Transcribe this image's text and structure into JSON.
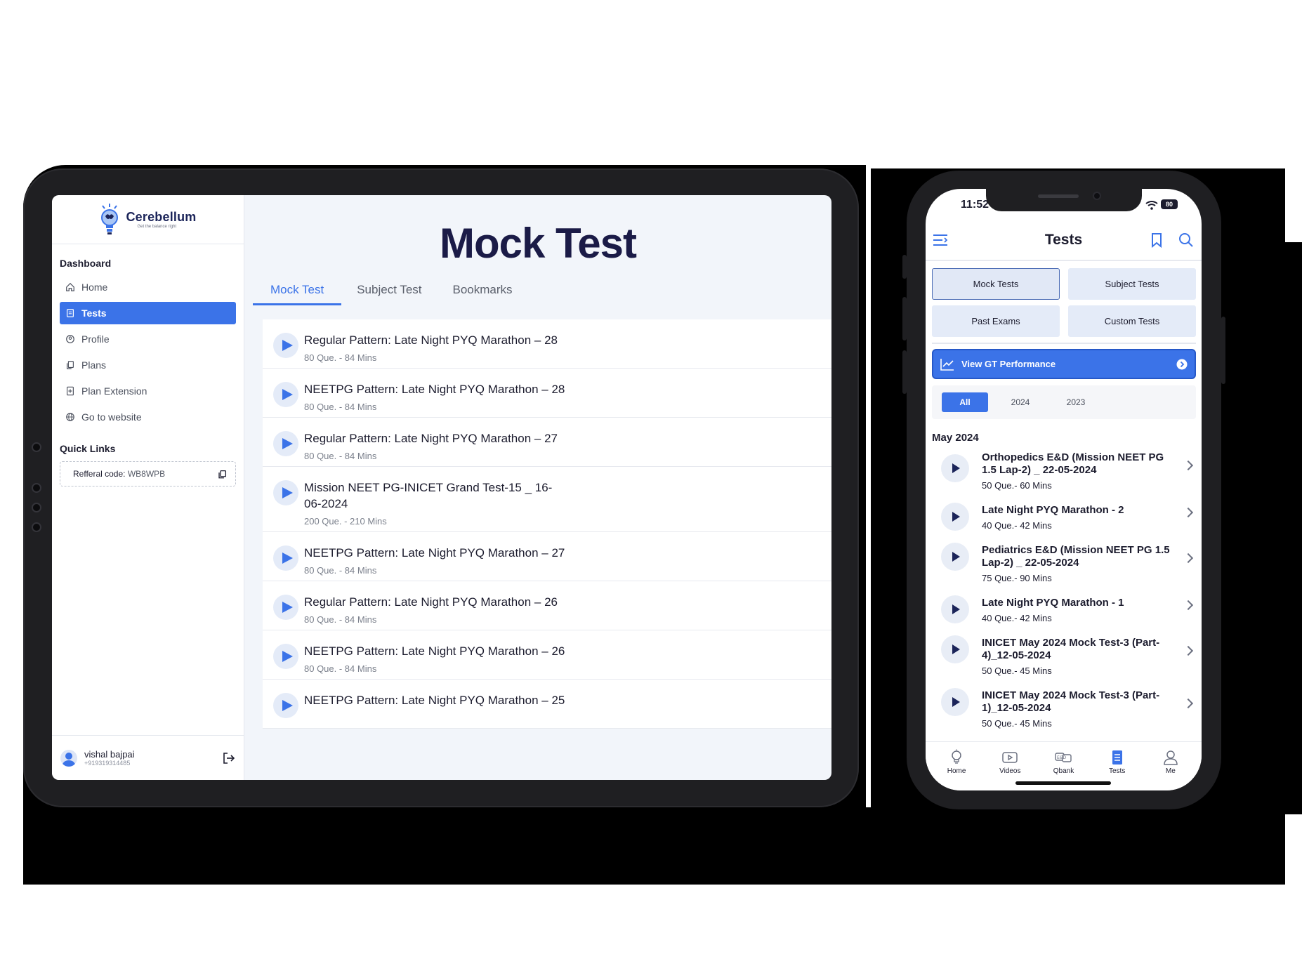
{
  "tablet": {
    "brand": {
      "name": "Cerebellum",
      "tagline": "Get the balance right"
    },
    "sidebar": {
      "section_label": "Dashboard",
      "items": [
        {
          "label": "Home",
          "icon": "home-icon"
        },
        {
          "label": "Tests",
          "icon": "document-icon",
          "active": true
        },
        {
          "label": "Profile",
          "icon": "user-circle-icon"
        },
        {
          "label": "Plans",
          "icon": "copy-icon"
        },
        {
          "label": "Plan Extension",
          "icon": "file-plus-icon"
        },
        {
          "label": "Go to website",
          "icon": "globe-icon"
        }
      ],
      "quick_links_label": "Quick Links",
      "referral_label": "Refferal code:",
      "referral_code": "WB8WPB"
    },
    "user": {
      "name": "vishal bajpai",
      "phone": "+919319314485"
    },
    "main": {
      "title": "Mock Test",
      "tabs": [
        "Mock Test",
        "Subject Test",
        "Bookmarks"
      ],
      "active_tab": "Mock Test",
      "tests": [
        {
          "title": "Regular Pattern: Late Night PYQ Marathon – 28",
          "meta": "80 Que. - 84 Mins"
        },
        {
          "title": "NEETPG Pattern: Late Night PYQ Marathon – 28",
          "meta": "80 Que. - 84 Mins"
        },
        {
          "title": "Regular Pattern: Late Night PYQ Marathon – 27",
          "meta": "80 Que. - 84 Mins"
        },
        {
          "title": "Mission NEET PG-INICET Grand Test-15 _ 16-06-2024",
          "meta": "200 Que. - 210 Mins"
        },
        {
          "title": "NEETPG Pattern: Late Night PYQ Marathon – 27",
          "meta": "80 Que. - 84 Mins"
        },
        {
          "title": "Regular Pattern: Late Night PYQ Marathon – 26",
          "meta": "80 Que. - 84 Mins"
        },
        {
          "title": "NEETPG Pattern: Late Night PYQ Marathon – 26",
          "meta": "80 Que. - 84 Mins"
        },
        {
          "title": "NEETPG Pattern: Late Night PYQ Marathon – 25",
          "meta": ""
        }
      ]
    }
  },
  "phone": {
    "status": {
      "time": "11:52",
      "battery": "80"
    },
    "header": {
      "title": "Tests"
    },
    "segments": [
      "Mock Tests",
      "Subject Tests",
      "Past Exams",
      "Custom Tests"
    ],
    "active_segment": "Mock Tests",
    "gt_button": "View GT Performance",
    "years": [
      "All",
      "2024",
      "2023"
    ],
    "active_year": "All",
    "month": "May 2024",
    "tests": [
      {
        "title": "Orthopedics E&D (Mission NEET PG 1.5 Lap-2) _ 22-05-2024",
        "meta": "50 Que.- 60 Mins"
      },
      {
        "title": "Late Night PYQ Marathon - 2",
        "meta": "40 Que.- 42 Mins"
      },
      {
        "title": "Pediatrics E&D (Mission NEET PG 1.5 Lap-2) _ 22-05-2024",
        "meta": "75 Que.- 90 Mins"
      },
      {
        "title": "Late Night PYQ Marathon - 1",
        "meta": "40 Que.- 42 Mins"
      },
      {
        "title": "INICET May 2024 Mock Test-3 (Part-4)_12-05-2024",
        "meta": "50 Que.- 45 Mins"
      },
      {
        "title": "INICET May 2024 Mock Test-3 (Part-1)_12-05-2024",
        "meta": "50 Que.- 45 Mins"
      }
    ],
    "nav": [
      {
        "label": "Home",
        "icon": "bulb-icon"
      },
      {
        "label": "Videos",
        "icon": "video-icon"
      },
      {
        "label": "Qbank",
        "icon": "qbank-icon"
      },
      {
        "label": "Tests",
        "icon": "tests-icon",
        "active": true
      },
      {
        "label": "Me",
        "icon": "user-icon"
      }
    ]
  },
  "colors": {
    "accent": "#3b73e8",
    "navy": "#1b1b47",
    "device": "#1f1f22"
  }
}
